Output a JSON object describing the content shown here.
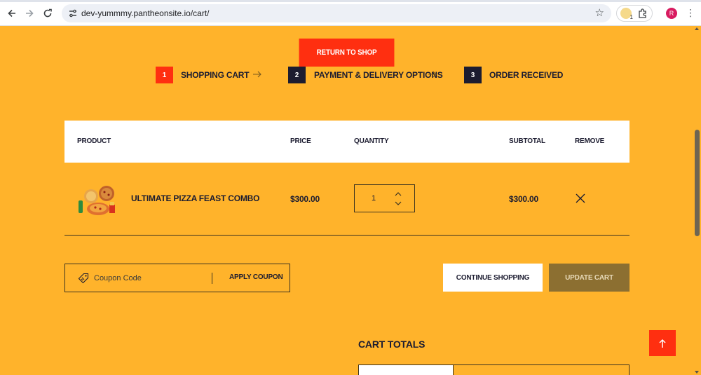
{
  "browser": {
    "url": "dev-yummmy.pantheonsite.io/cart/",
    "extension_badge": "1",
    "profile_initial": "R"
  },
  "page": {
    "return_button": "Return to shop",
    "steps": [
      {
        "number": "1",
        "label": "Shopping Cart",
        "color": "#ff2f10"
      },
      {
        "number": "2",
        "label": "Payment & Delivery Options",
        "color": "#1c1c30"
      },
      {
        "number": "3",
        "label": "Order Received",
        "color": "#1c1c30"
      }
    ],
    "table": {
      "headers": {
        "product": "Product",
        "price": "Price",
        "quantity": "Quantity",
        "subtotal": "Subtotal",
        "remove": "Remove"
      },
      "rows": [
        {
          "product": "Ultimate Pizza Feast Combo",
          "price": "$300.00",
          "quantity": "1",
          "subtotal": "$300.00"
        }
      ]
    },
    "coupon": {
      "placeholder": "Coupon Code",
      "apply_label": "Apply Coupon"
    },
    "continue_label": "Continue Shopping",
    "update_label": "Update Cart",
    "cart_totals_title": "Cart Totals"
  },
  "colors": {
    "background": "#ffb32b",
    "accent": "#ff2f10",
    "dark": "#1c1c30",
    "update_button": "#8c6f31"
  },
  "icons": [
    "back-icon",
    "forward-icon",
    "reload-icon",
    "site-settings-icon",
    "star-icon",
    "extensions-icon",
    "more-icon",
    "arrow-right-icon",
    "chevron-up-icon",
    "chevron-down-icon",
    "close-icon",
    "coupon-tag-icon",
    "arrow-up-icon"
  ]
}
